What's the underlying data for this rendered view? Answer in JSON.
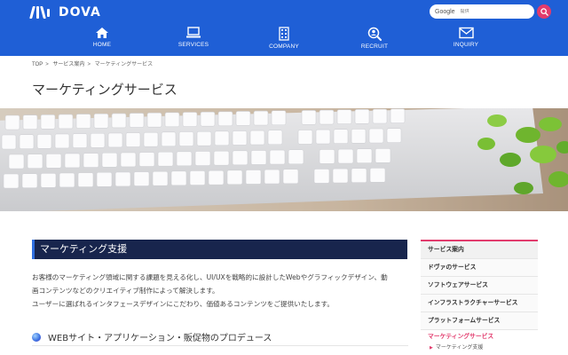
{
  "brand": {
    "name": "DOVA"
  },
  "search": {
    "provider_label": "Google",
    "placeholder": "提供"
  },
  "nav": {
    "items": [
      {
        "label": "HOME",
        "icon": "home-icon"
      },
      {
        "label": "SERVICES",
        "icon": "laptop-icon"
      },
      {
        "label": "COMPANY",
        "icon": "building-icon"
      },
      {
        "label": "RECRUIT",
        "icon": "person-search-icon"
      },
      {
        "label": "INQUIRY",
        "icon": "mail-icon"
      }
    ]
  },
  "breadcrumb": {
    "items": [
      "TOP",
      "サービス案内",
      "マーケティングサービス"
    ],
    "separator": ">"
  },
  "page": {
    "title": "マーケティングサービス"
  },
  "content": {
    "section_title": "マーケティング支援",
    "paragraphs": [
      "お客様のマーケティング領域に関する課題を見える化し、UI/UXを戦略的に設計したWebやグラフィックデザイン、動",
      "画コンテンツなどのクリエイティブ制作によって解決します。",
      "ユーザーに選ばれるインタフェースデザインにこだわり、価値あるコンテンツをご提供いたします。"
    ],
    "sub_heading": "WEBサイト・アプリケーション・販促物のプロデュース"
  },
  "sidebar": {
    "heading": "サービス案内",
    "items": [
      "ドヴァのサービス",
      "ソフトウェアサービス",
      "インフラストラクチャーサービス",
      "プラットフォームサービス"
    ],
    "active": "マーケティングサービス",
    "sub_items": [
      "マーケティング支援"
    ]
  },
  "colors": {
    "header_bg": "#1f5fd6",
    "accent_pink": "#e23b6d",
    "section_head_bg": "#18254d"
  }
}
